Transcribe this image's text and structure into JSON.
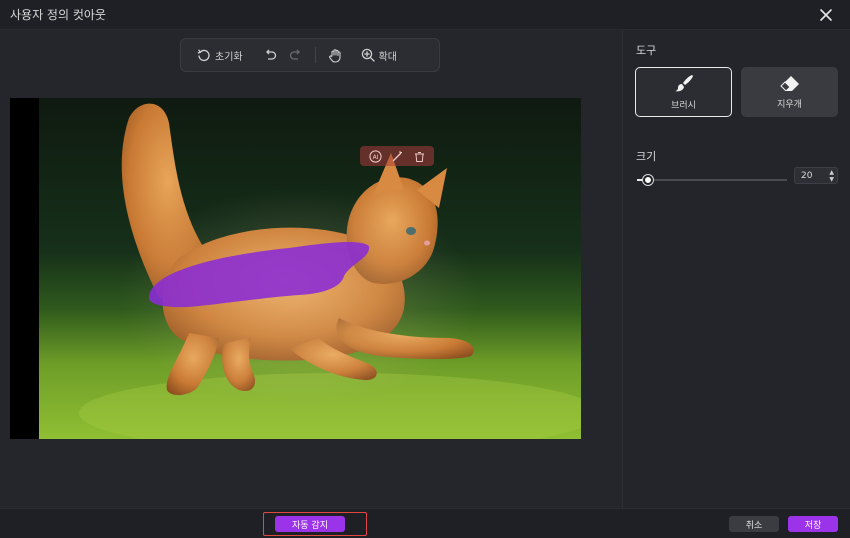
{
  "window": {
    "title": "사용자 정의 컷아웃"
  },
  "toolbar": {
    "reset_label": "초기화",
    "zoom_label": "확대"
  },
  "panel": {
    "tools_heading": "도구",
    "brush_label": "브러시",
    "eraser_label": "지우개",
    "size_heading": "크기",
    "size_value": "20",
    "size_fraction": 0.05
  },
  "footer": {
    "auto_detect_label": "자동 감지",
    "cancel_label": "취소",
    "save_label": "저장"
  },
  "colors": {
    "accent": "#9b33e8",
    "highlight": "#e0473f"
  },
  "icons": [
    "close-icon",
    "reset-icon",
    "undo-icon",
    "redo-icon",
    "hand-icon",
    "zoom-in-icon",
    "brush-icon",
    "eraser-icon",
    "ai-icon"
  ]
}
